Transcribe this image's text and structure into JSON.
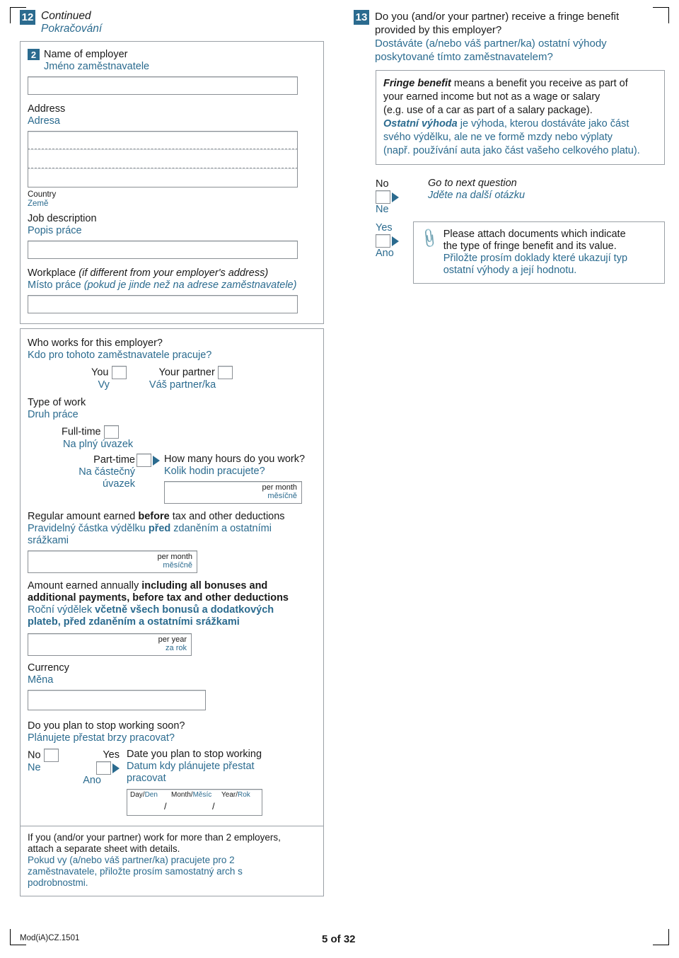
{
  "left": {
    "q_number": "12",
    "q_title_en": "Continued",
    "q_title_cz": "Pokračování",
    "sub_number": "2",
    "employer_name_en": "Name of employer",
    "employer_name_cz": "Jméno zaměstnavatele",
    "address_en": "Address",
    "address_cz": "Adresa",
    "country_en": "Country",
    "country_cz": "Země",
    "job_desc_en": "Job description",
    "job_desc_cz": "Popis práce",
    "workplace_en_plain": "Workplace ",
    "workplace_en_italic": "(if different from your employer's address)",
    "workplace_cz_plain": "Místo práce ",
    "workplace_cz_italic": "(pokud je jinde než na adrese zaměstnavatele)",
    "who_works_en": "Who works for this employer?",
    "who_works_cz": "Kdo pro tohoto zaměstnavatele pracuje?",
    "you_en": "You",
    "you_cz": "Vy",
    "partner_en": "Your partner",
    "partner_cz": "Váš partner/ka",
    "type_work_en": "Type of work",
    "type_work_cz": "Druh práce",
    "fulltime_en": "Full-time",
    "fulltime_cz": "Na plný úvazek",
    "parttime_en": "Part-time",
    "parttime_cz_1": "Na částečný",
    "parttime_cz_2": "úvazek",
    "hours_en": "How many hours do you work?",
    "hours_cz": "Kolik hodin pracujete?",
    "per_month_en": "per month",
    "per_month_cz": "měsíčně",
    "regular_en_1": "Regular amount earned ",
    "regular_en_b": "before",
    "regular_en_2": " tax and other deductions",
    "regular_cz_1": "Pravidelný částka výdělku ",
    "regular_cz_b": "před",
    "regular_cz_2": " zdaněním a ostatními",
    "regular_cz_3": "srážkami",
    "annual_en_1": "Amount earned annually ",
    "annual_en_b1": "including all bonuses and",
    "annual_en_b2": "additional payments, before tax and other deductions",
    "annual_cz_1": "Roční výdělek ",
    "annual_cz_b1": "včetně všech bonusů a dodatkových",
    "annual_cz_b2": "plateb, před zdaněním a ostatními srážkami",
    "per_year_en": "per year",
    "per_year_cz": "za rok",
    "currency_en": "Currency",
    "currency_cz": "Měna",
    "stop_en": "Do you plan to stop working soon?",
    "stop_cz": "Plánujete přestat brzy pracovat?",
    "no_en": "No",
    "no_cz": "Ne",
    "yes_en": "Yes",
    "yes_cz": "Ano",
    "date_stop_en": "Date you plan to stop working",
    "date_stop_cz_1": "Datum kdy plánujete přestat",
    "date_stop_cz_2": "pracovat",
    "day_en": "Day/",
    "day_cz": "Den",
    "month_en": "Month/",
    "month_cz": "Měsíc",
    "year_en": "Year/",
    "year_cz": "Rok",
    "slash": "/",
    "note_en_1": "If you (and/or your partner) work for more than 2 employers,",
    "note_en_2": "attach a separate sheet with details.",
    "note_cz_1": "Pokud vy (a/nebo váš partner/ka) pracujete pro 2",
    "note_cz_2": "zaměstnavatele, přiložte prosím samostatný arch s",
    "note_cz_3": "podrobnostmi."
  },
  "right": {
    "q_number": "13",
    "q_en_1": "Do you (and/or your partner) receive a fringe benefit",
    "q_en_2": "provided by this employer?",
    "q_cz_1": "Dostáváte (a/nebo váš partner/ka) ostatní výhody",
    "q_cz_2": "poskytované tímto zaměstnavatelem?",
    "fringe_term_en": "Fringe benefit",
    "fringe_def_en_1": " means a benefit you receive as part of",
    "fringe_def_en_2": "your earned income but not as a wage or salary",
    "fringe_def_en_3": "(e.g. use of a car as part of a salary package).",
    "fringe_term_cz": "Ostatní výhoda",
    "fringe_def_cz_1": " je výhoda, kterou dostáváte jako část",
    "fringe_def_cz_2": "svého výdělku, ale ne ve formě mzdy nebo výplaty",
    "fringe_def_cz_3": "(např. používání auta jako část vašeho celkového platu).",
    "no_en": "No",
    "no_cz": "Ne",
    "yes_en": "Yes",
    "yes_cz": "Ano",
    "goto_en": "Go to next question",
    "goto_cz": "Jděte na další otázku",
    "attach_en_1": "Please attach documents which indicate",
    "attach_en_2": "the type of fringe benefit and its value.",
    "attach_cz_1": "Přiložte prosím doklady které ukazují typ",
    "attach_cz_2": "ostatní výhody a její hodnotu."
  },
  "footer": {
    "form_code": "Mod(iA)CZ.1501",
    "page": "5 of 32"
  },
  "colors": {
    "accent": "#2b6b8f",
    "rule": "#9aa0a6"
  }
}
